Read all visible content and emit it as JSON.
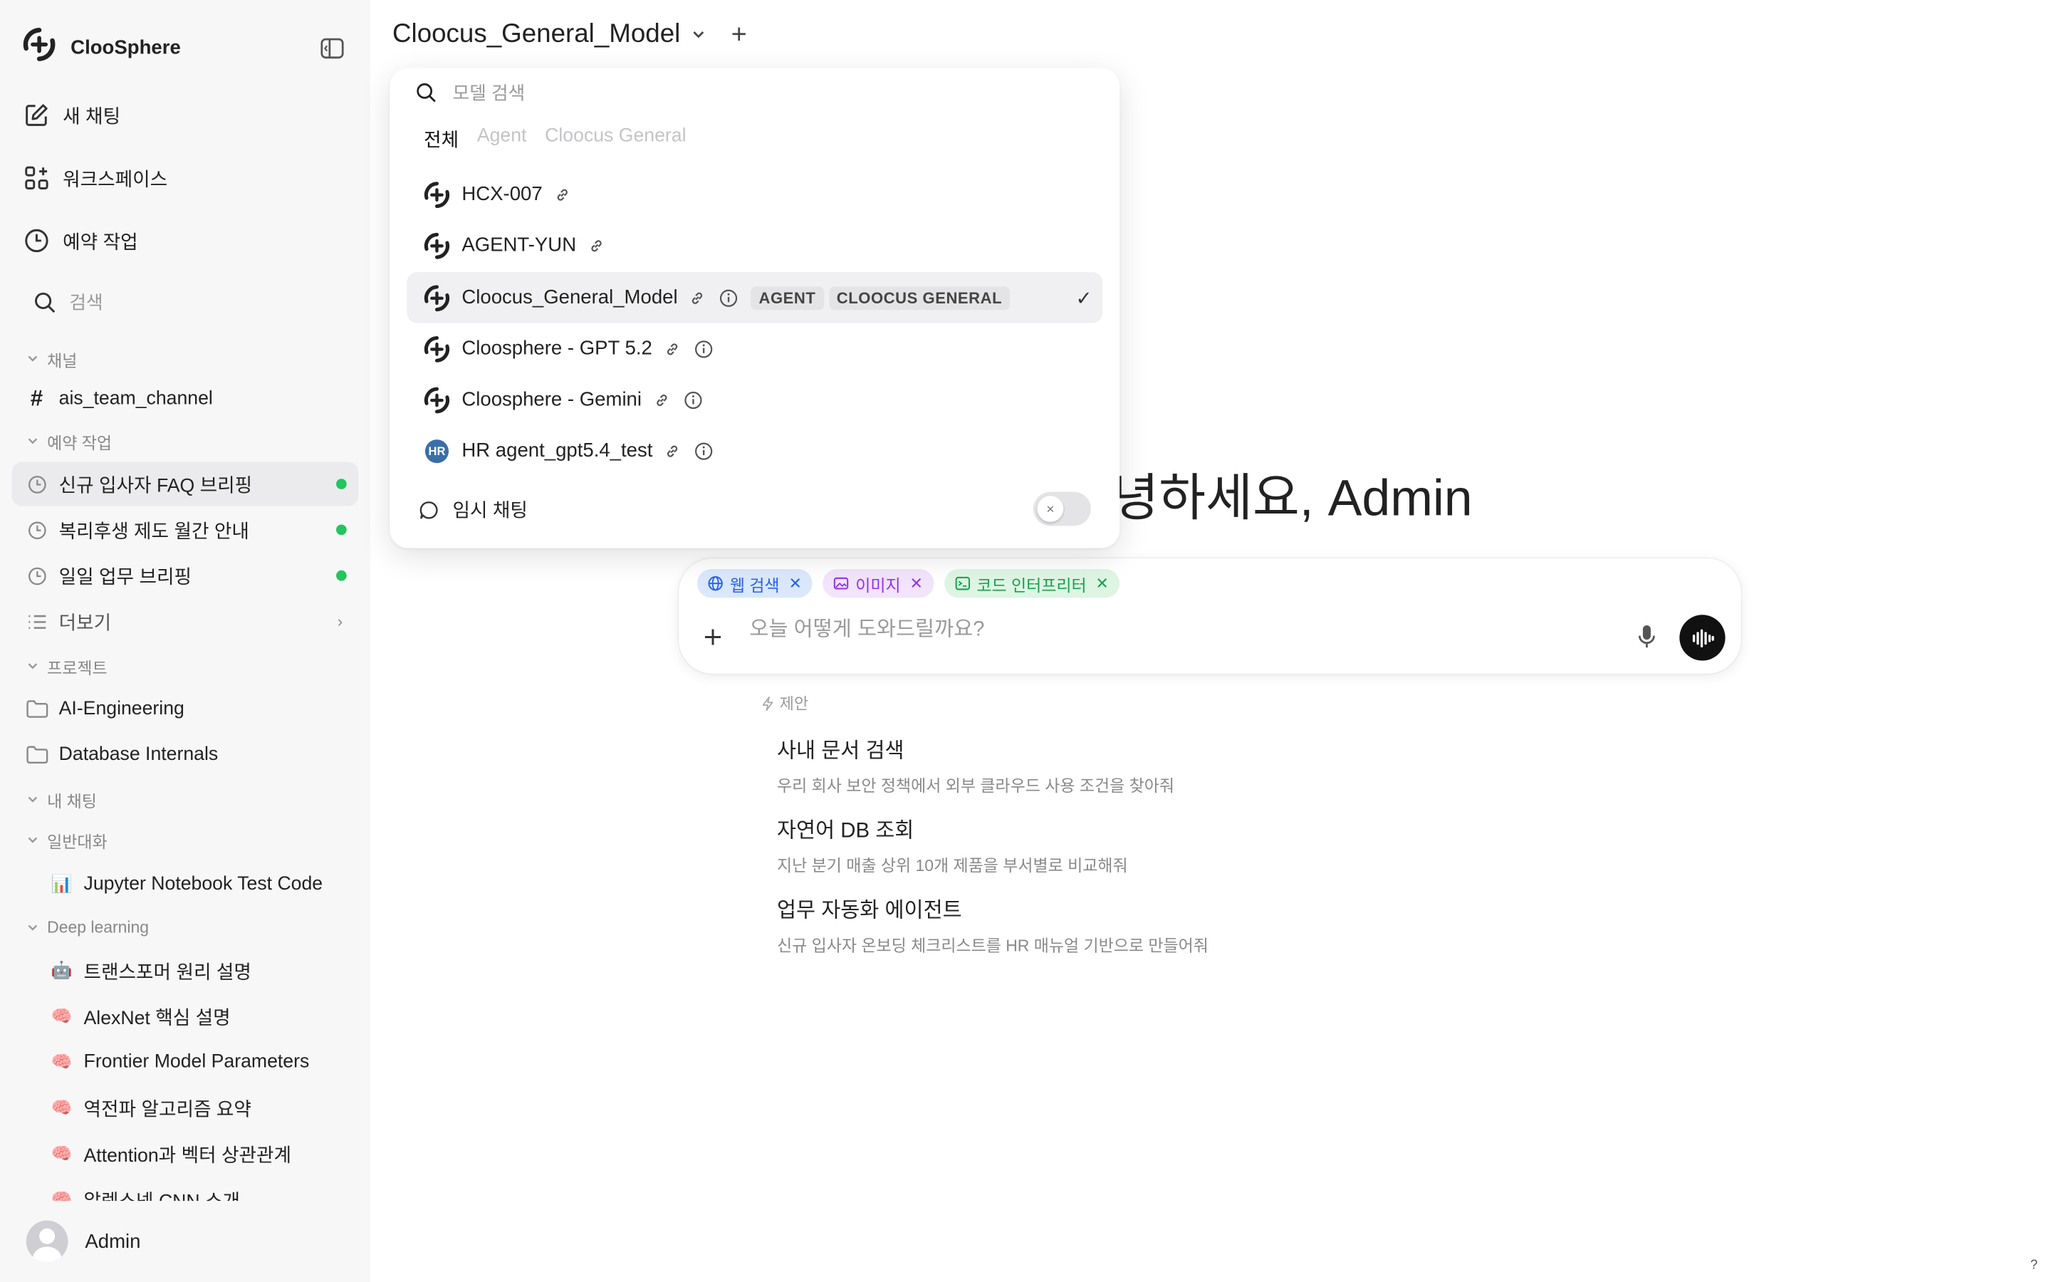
{
  "sidebar": {
    "brand": "ClooSphere",
    "nav": [
      {
        "label": "새 채팅",
        "icon": "edit-icon"
      },
      {
        "label": "워크스페이스",
        "icon": "apps-icon"
      },
      {
        "label": "예약 작업",
        "icon": "clock-icon"
      }
    ],
    "search_placeholder": "검색",
    "sections": {
      "channels": "채널",
      "scheduled": "예약 작업",
      "projects": "프로젝트",
      "my_chats": "내 채팅",
      "general": "일반대화",
      "deep_learning": "Deep learning"
    },
    "channel": "ais_team_channel",
    "scheduled_items": [
      {
        "label": "신규 입사자 FAQ 브리핑"
      },
      {
        "label": "복리후생 제도 월간 안내"
      },
      {
        "label": "일일 업무 브리핑"
      }
    ],
    "more": "더보기",
    "projects": [
      {
        "label": "AI-Engineering"
      },
      {
        "label": "Database Internals"
      }
    ],
    "general_chats": [
      {
        "emoji": "📊",
        "label": "Jupyter Notebook Test Code"
      }
    ],
    "deep_learning_chats": [
      {
        "emoji": "🤖",
        "label": "트랜스포머 원리 설명"
      },
      {
        "emoji": "🧠",
        "label": "AlexNet 핵심 설명"
      },
      {
        "emoji": "🧠",
        "label": "Frontier Model Parameters"
      },
      {
        "emoji": "🧠",
        "label": "역전파 알고리즘 요약"
      },
      {
        "emoji": "🧠",
        "label": "Attention과 벡터 상관관계"
      },
      {
        "emoji": "🧠",
        "label": "알렉스넷 CNN 소개"
      }
    ],
    "user": "Admin"
  },
  "header": {
    "model": "Cloocus_General_Model"
  },
  "model_menu": {
    "search_placeholder": "모델 검색",
    "tabs": [
      "전체",
      "Agent",
      "Cloocus General"
    ],
    "models": [
      {
        "name": "HCX-007",
        "info": false,
        "tags": [],
        "selected": false
      },
      {
        "name": "AGENT-YUN",
        "info": false,
        "tags": [],
        "selected": false
      },
      {
        "name": "Cloocus_General_Model",
        "info": true,
        "tags": [
          "AGENT",
          "CLOOCUS GENERAL"
        ],
        "selected": true
      },
      {
        "name": "Cloosphere - GPT 5.2",
        "info": true,
        "tags": [],
        "selected": false
      },
      {
        "name": "Cloosphere - Gemini",
        "info": true,
        "tags": [],
        "selected": false
      },
      {
        "name": "HR agent_gpt5.4_test",
        "info": true,
        "tags": [],
        "selected": false,
        "logo_text": "HR"
      }
    ],
    "temp_chat": "임시 채팅"
  },
  "main": {
    "greeting": "녕하세요, Admin",
    "chips": [
      {
        "label": "웹 검색",
        "kind": "web"
      },
      {
        "label": "이미지",
        "kind": "img"
      },
      {
        "label": "코드 인터프리터",
        "kind": "code"
      }
    ],
    "input_placeholder": "오늘 어떻게 도와드릴까요?",
    "suggestions_header": "제안",
    "suggestions": [
      {
        "title": "사내 문서 검색",
        "desc": "우리 회사 보안 정책에서 외부 클라우드 사용 조건을 찾아줘"
      },
      {
        "title": "자연어 DB 조회",
        "desc": "지난 분기 매출 상위 10개 제품을 부서별로 비교해줘"
      },
      {
        "title": "업무 자동화 에이전트",
        "desc": "신규 입사자 온보딩 체크리스트를 HR 매뉴얼 기반으로 만들어줘"
      }
    ],
    "help": "?"
  }
}
